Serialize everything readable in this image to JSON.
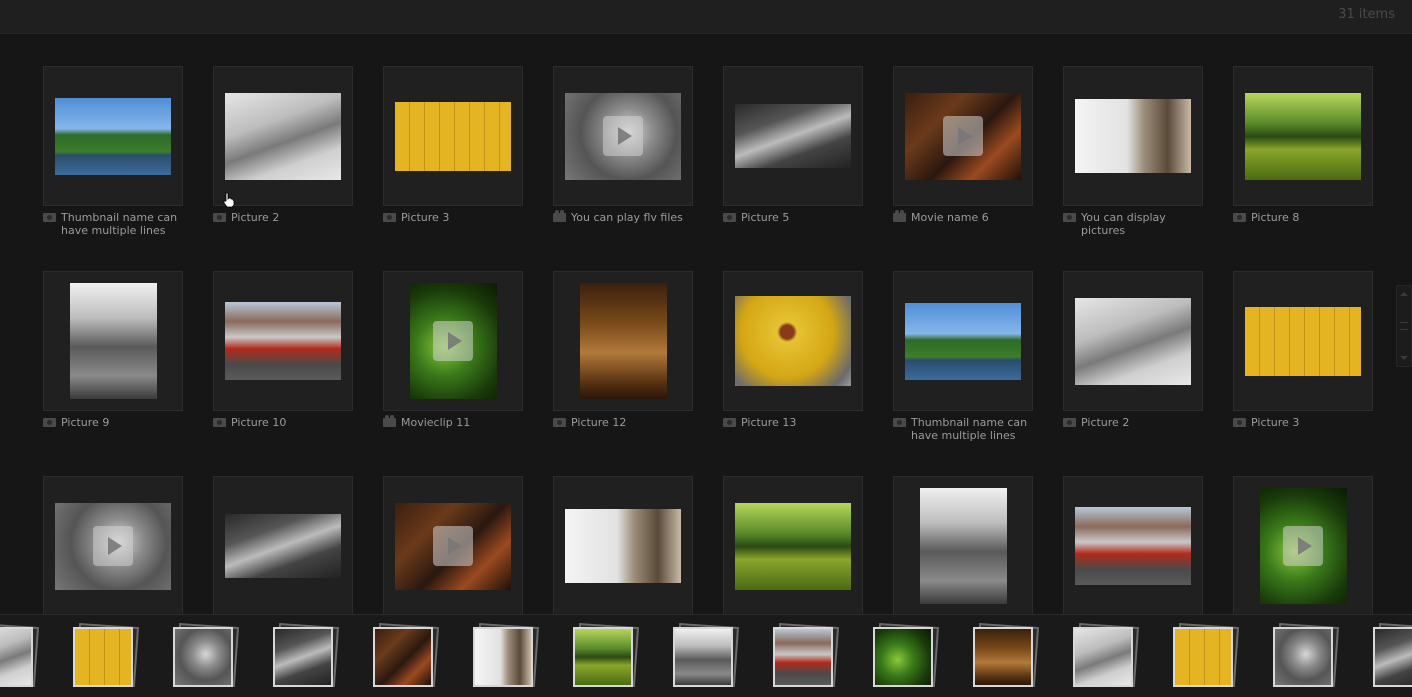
{
  "header": {
    "item_count": "31 items"
  },
  "grid": {
    "items": [
      {
        "caption": "Thumbnail name can have multiple lines",
        "kind": "photo",
        "image": "lake-trees"
      },
      {
        "caption": "Picture 2",
        "kind": "photo",
        "image": "snowy-road"
      },
      {
        "caption": "Picture 3",
        "kind": "photo",
        "image": "yellow-ruler"
      },
      {
        "caption": "You can play flv files",
        "kind": "movie",
        "image": "pinecone"
      },
      {
        "caption": "Picture 5",
        "kind": "photo",
        "image": "bw-road-car"
      },
      {
        "caption": "Movie name 6",
        "kind": "movie",
        "image": "warning-sign"
      },
      {
        "caption": "You can display pictures",
        "kind": "photo",
        "image": "cat"
      },
      {
        "caption": "Picture 8",
        "kind": "photo",
        "image": "green-river"
      },
      {
        "caption": "Picture 9",
        "kind": "photo",
        "image": "bw-statues"
      },
      {
        "caption": "Picture 10",
        "kind": "photo",
        "image": "fire-station"
      },
      {
        "caption": "Movieclip 11",
        "kind": "movie",
        "image": "green-moss"
      },
      {
        "caption": "Picture 12",
        "kind": "photo",
        "image": "barrels"
      },
      {
        "caption": "Picture 13",
        "kind": "photo",
        "image": "yellow-hydrant"
      },
      {
        "caption": "Thumbnail name can have multiple lines",
        "kind": "photo",
        "image": "lake-trees"
      },
      {
        "caption": "Picture 2",
        "kind": "photo",
        "image": "snowy-road"
      },
      {
        "caption": "Picture 3",
        "kind": "photo",
        "image": "yellow-ruler"
      },
      {
        "caption": "",
        "kind": "movie",
        "image": "pinecone"
      },
      {
        "caption": "",
        "kind": "photo",
        "image": "bw-road-car"
      },
      {
        "caption": "",
        "kind": "movie",
        "image": "warning-sign"
      },
      {
        "caption": "",
        "kind": "photo",
        "image": "cat"
      },
      {
        "caption": "",
        "kind": "photo",
        "image": "green-river"
      },
      {
        "caption": "",
        "kind": "photo",
        "image": "bw-statues"
      },
      {
        "caption": "",
        "kind": "photo",
        "image": "fire-station"
      },
      {
        "caption": "",
        "kind": "movie",
        "image": "green-moss"
      }
    ]
  },
  "filmstrip": {
    "images": [
      "snowy-road",
      "yellow-ruler",
      "pinecone",
      "bw-road-car",
      "warning-sign",
      "cat",
      "green-river",
      "bw-statues",
      "fire-station",
      "green-moss",
      "barrels",
      "snowy-road",
      "yellow-ruler",
      "pinecone",
      "bw-road-car"
    ]
  },
  "colors": {
    "background": "#161616",
    "frame": "#202020",
    "caption": "#9a9a9a",
    "strip_border": "#d8d8d8"
  }
}
